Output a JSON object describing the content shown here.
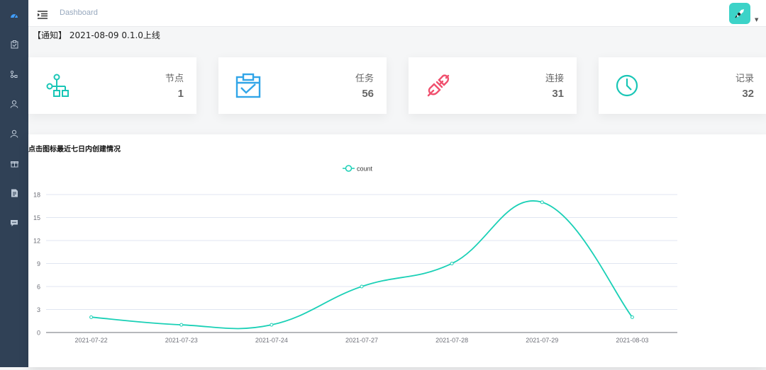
{
  "sidebar": {
    "items": [
      {
        "icon": "dashboard-icon",
        "active": true
      },
      {
        "icon": "clipboard-icon",
        "active": false
      },
      {
        "icon": "network-node-icon",
        "active": false
      },
      {
        "icon": "user-icon",
        "active": false
      },
      {
        "icon": "user-icon",
        "active": false
      },
      {
        "icon": "gift-icon",
        "active": false
      },
      {
        "icon": "document-icon",
        "active": false
      },
      {
        "icon": "chat-icon",
        "active": false
      }
    ],
    "background": "#304156",
    "active_color": "#409eff"
  },
  "header": {
    "breadcrumb": "Dashboard",
    "avatar_color": "#3cd3c8"
  },
  "notice": "【通知】 2021-08-09 0.1.0上线",
  "cards": [
    {
      "title": "节点",
      "value": "1",
      "icon": "node-tree-icon",
      "color": "#19c6b6"
    },
    {
      "title": "任务",
      "value": "56",
      "icon": "task-clipboard-icon",
      "color": "#31a5e8"
    },
    {
      "title": "连接",
      "value": "31",
      "icon": "plug-connection-icon",
      "color": "#f0506e"
    },
    {
      "title": "记录",
      "value": "32",
      "icon": "clock-icon",
      "color": "#19c6b6"
    }
  ],
  "chart_heading": "点击图标最近七日内创建情况",
  "chart_data": {
    "type": "line",
    "categories": [
      "2021-07-22",
      "2021-07-23",
      "2021-07-24",
      "2021-07-27",
      "2021-07-28",
      "2021-07-29",
      "2021-08-03"
    ],
    "series": [
      {
        "name": "count",
        "values": [
          2,
          1,
          1,
          6,
          9,
          17,
          2
        ],
        "color": "#1ad0b6"
      }
    ],
    "yticks": [
      0,
      3,
      6,
      9,
      12,
      15,
      18
    ],
    "ylim": [
      0,
      18
    ],
    "smooth": true,
    "grid": true,
    "legend": "top-center"
  }
}
